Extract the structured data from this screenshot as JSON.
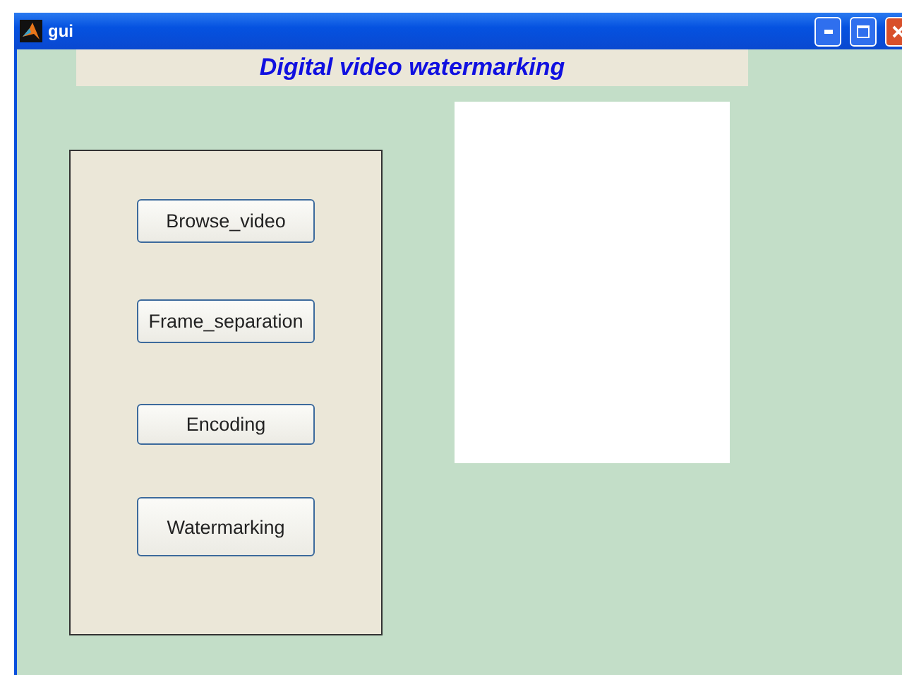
{
  "window": {
    "title": "gui"
  },
  "heading": "Digital video watermarking",
  "buttons": [
    {
      "label": "Browse_video"
    },
    {
      "label": "Frame_separation"
    },
    {
      "label": "Encoding"
    },
    {
      "label": "Watermarking"
    }
  ],
  "axes": {
    "kind": "blank"
  }
}
